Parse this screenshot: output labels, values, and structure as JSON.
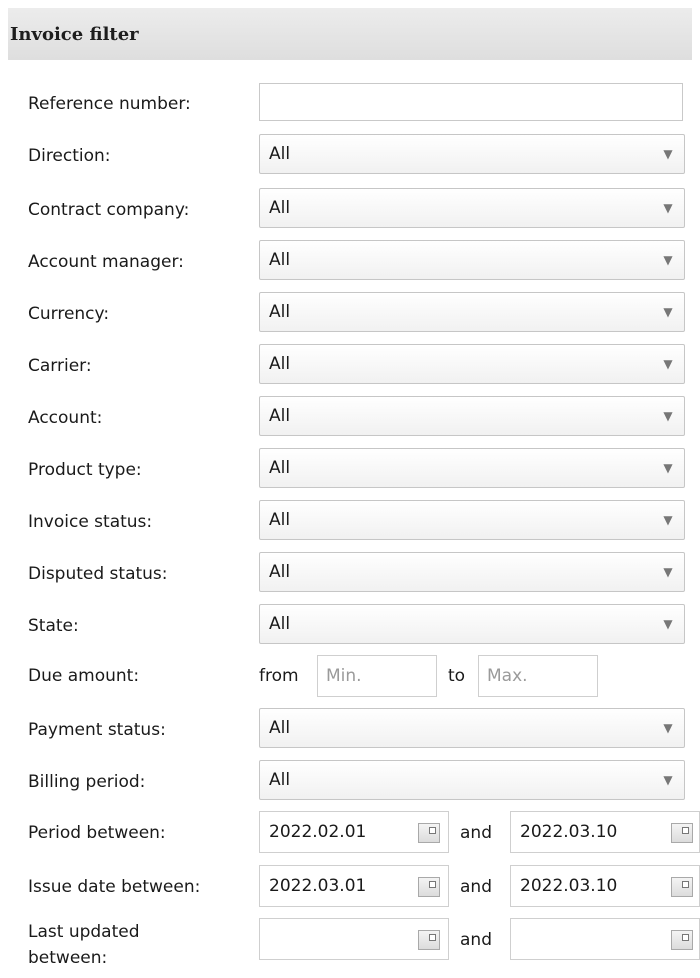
{
  "header": {
    "title": "Invoice filter"
  },
  "fields": {
    "reference_number": {
      "label": "Reference number:",
      "value": ""
    },
    "direction": {
      "label": "Direction:",
      "value": "All"
    },
    "contract_company": {
      "label": "Contract company:",
      "value": "All"
    },
    "account_manager": {
      "label": "Account manager:",
      "value": "All"
    },
    "currency": {
      "label": "Currency:",
      "value": "All"
    },
    "carrier": {
      "label": "Carrier:",
      "value": "All"
    },
    "account": {
      "label": "Account:",
      "value": "All"
    },
    "product_type": {
      "label": "Product type:",
      "value": "All"
    },
    "invoice_status": {
      "label": "Invoice status:",
      "value": "All"
    },
    "disputed_status": {
      "label": "Disputed status:",
      "value": "All"
    },
    "state": {
      "label": "State:",
      "value": "All"
    },
    "due_amount": {
      "label": "Due amount:",
      "from_label": "from",
      "to_label": "to",
      "min_placeholder": "Min.",
      "max_placeholder": "Max."
    },
    "payment_status": {
      "label": "Payment status:",
      "value": "All"
    },
    "billing_period": {
      "label": "Billing period:",
      "value": "All"
    },
    "period_between": {
      "label": "Period between:",
      "from": "2022.02.01",
      "and_label": "and",
      "to": "2022.03.10"
    },
    "issue_date_between": {
      "label": "Issue date between:",
      "from": "2022.03.01",
      "and_label": "and",
      "to": "2022.03.10"
    },
    "last_updated_between": {
      "label_line1": "Last updated",
      "label_line2": "between:",
      "from": "",
      "and_label": "and",
      "to": ""
    }
  },
  "icons": {
    "dropdown": "chevron-down-icon",
    "calendar": "calendar-icon"
  }
}
